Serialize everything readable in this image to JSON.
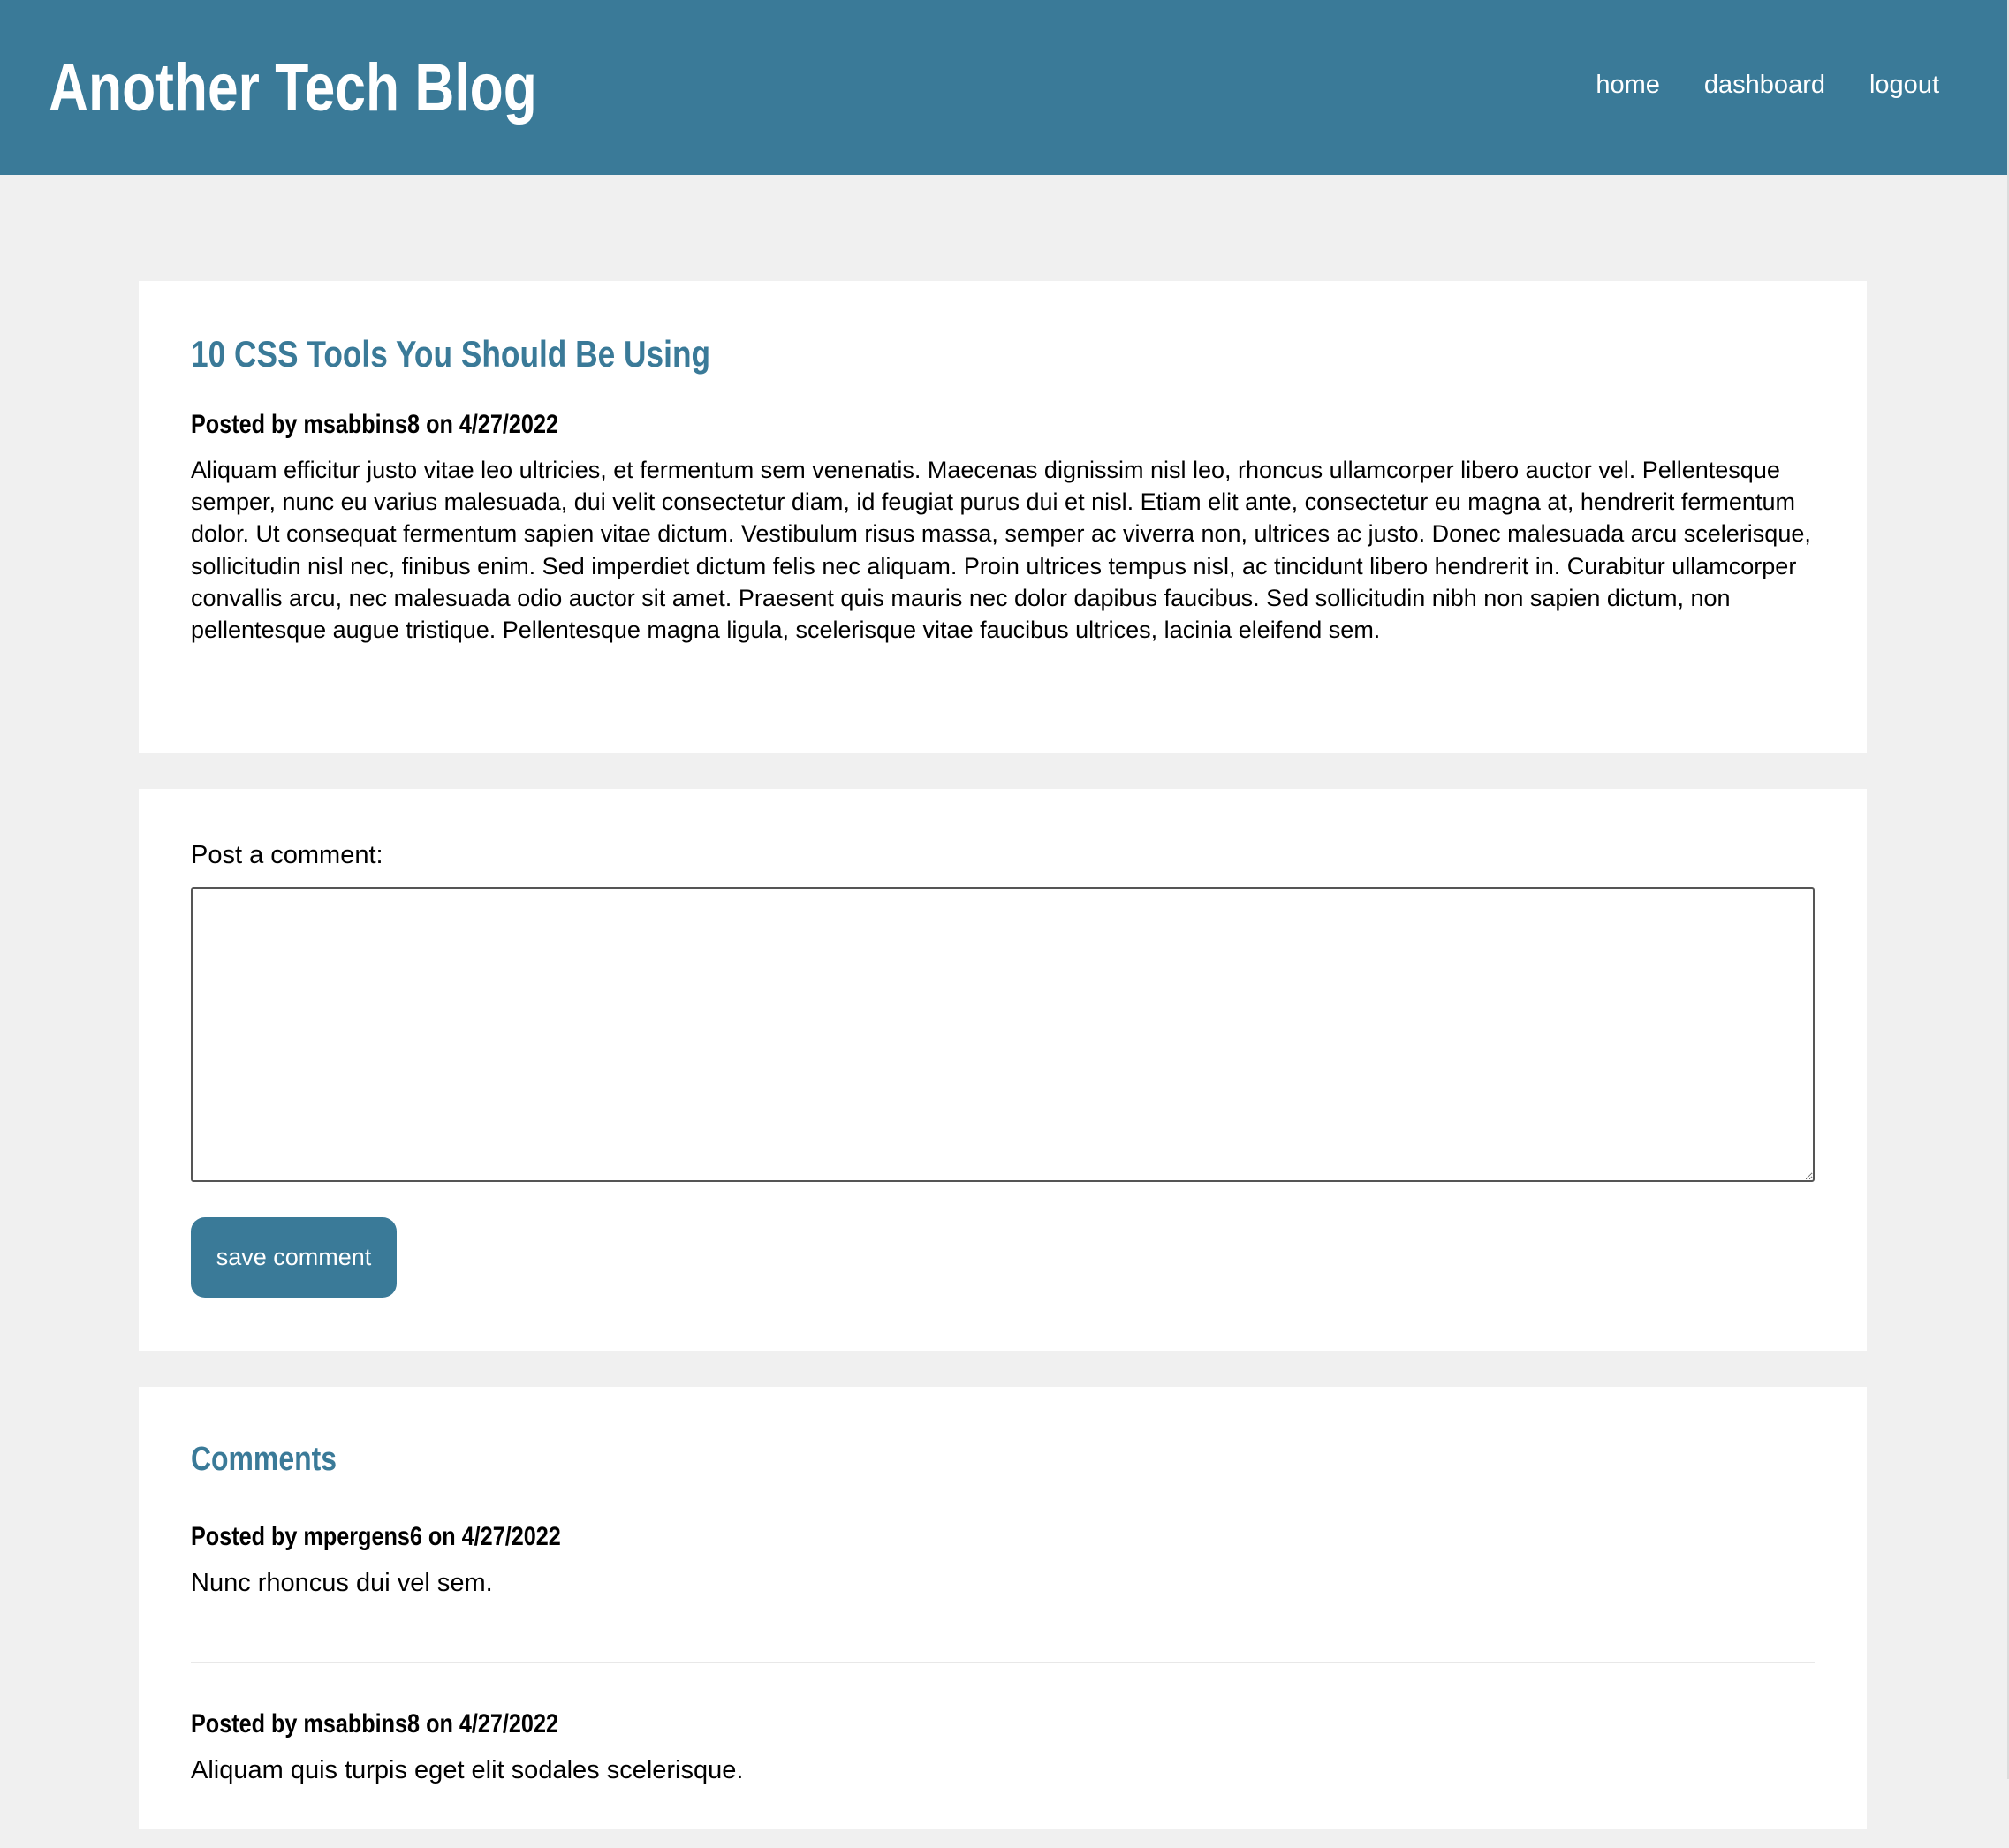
{
  "header": {
    "site_title": "Another Tech Blog",
    "nav": [
      "home",
      "dashboard",
      "logout"
    ]
  },
  "post": {
    "title": "10 CSS Tools You Should Be Using",
    "meta": "Posted by msabbins8 on 4/27/2022",
    "body": "Aliquam efficitur justo vitae leo ultricies, et fermentum sem venenatis. Maecenas dignissim nisl leo, rhoncus ullamcorper libero auctor vel. Pellentesque semper, nunc eu varius malesuada, dui velit consectetur diam, id feugiat purus dui et nisl. Etiam elit ante, consectetur eu magna at, hendrerit fermentum dolor. Ut consequat fermentum sapien vitae dictum. Vestibulum risus massa, semper ac viverra non, ultrices ac justo. Donec malesuada arcu scelerisque, sollicitudin nisl nec, finibus enim. Sed imperdiet dictum felis nec aliquam. Proin ultrices tempus nisl, ac tincidunt libero hendrerit in. Curabitur ullamcorper convallis arcu, nec malesuada odio auctor sit amet. Praesent quis mauris nec dolor dapibus faucibus. Sed sollicitudin nibh non sapien dictum, non pellentesque augue tristique. Pellentesque magna ligula, scelerisque vitae faucibus ultrices, lacinia eleifend sem."
  },
  "comment_form": {
    "label": "Post a comment:",
    "textarea_value": "",
    "save_label": "save comment"
  },
  "comments": {
    "title": "Comments",
    "items": [
      {
        "meta": "Posted by mpergens6 on 4/27/2022",
        "text": "Nunc rhoncus dui vel sem."
      },
      {
        "meta": "Posted by msabbins8 on 4/27/2022",
        "text": "Aliquam quis turpis eget elit sodales scelerisque."
      }
    ]
  },
  "colors": {
    "accent": "#3a7a98",
    "page_background": "#f0f0f0",
    "card_background": "#ffffff",
    "text": "#000000"
  }
}
